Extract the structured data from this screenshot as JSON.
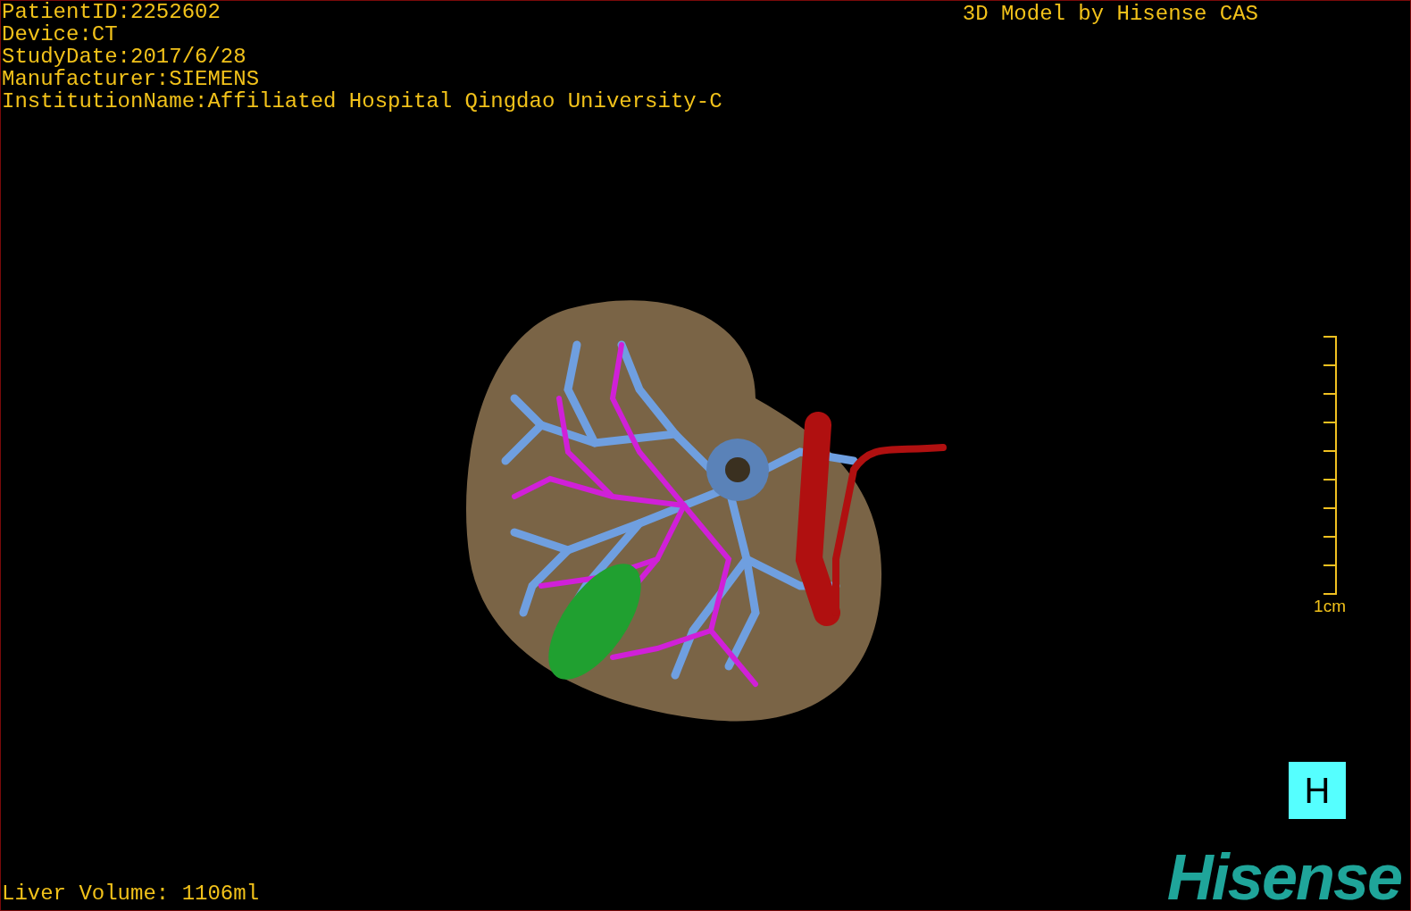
{
  "info_lines": [
    "PatientID:2252602",
    "Device:CT",
    "StudyDate:2017/6/28",
    "Manufacturer:SIEMENS",
    "InstitutionName:Affiliated Hospital Qingdao University-C"
  ],
  "title": "3D Model by Hisense CAS",
  "scale_label": "1cm",
  "orientation_button": "H",
  "liver_volume": "Liver Volume: 1106ml",
  "logo": "Hisense"
}
